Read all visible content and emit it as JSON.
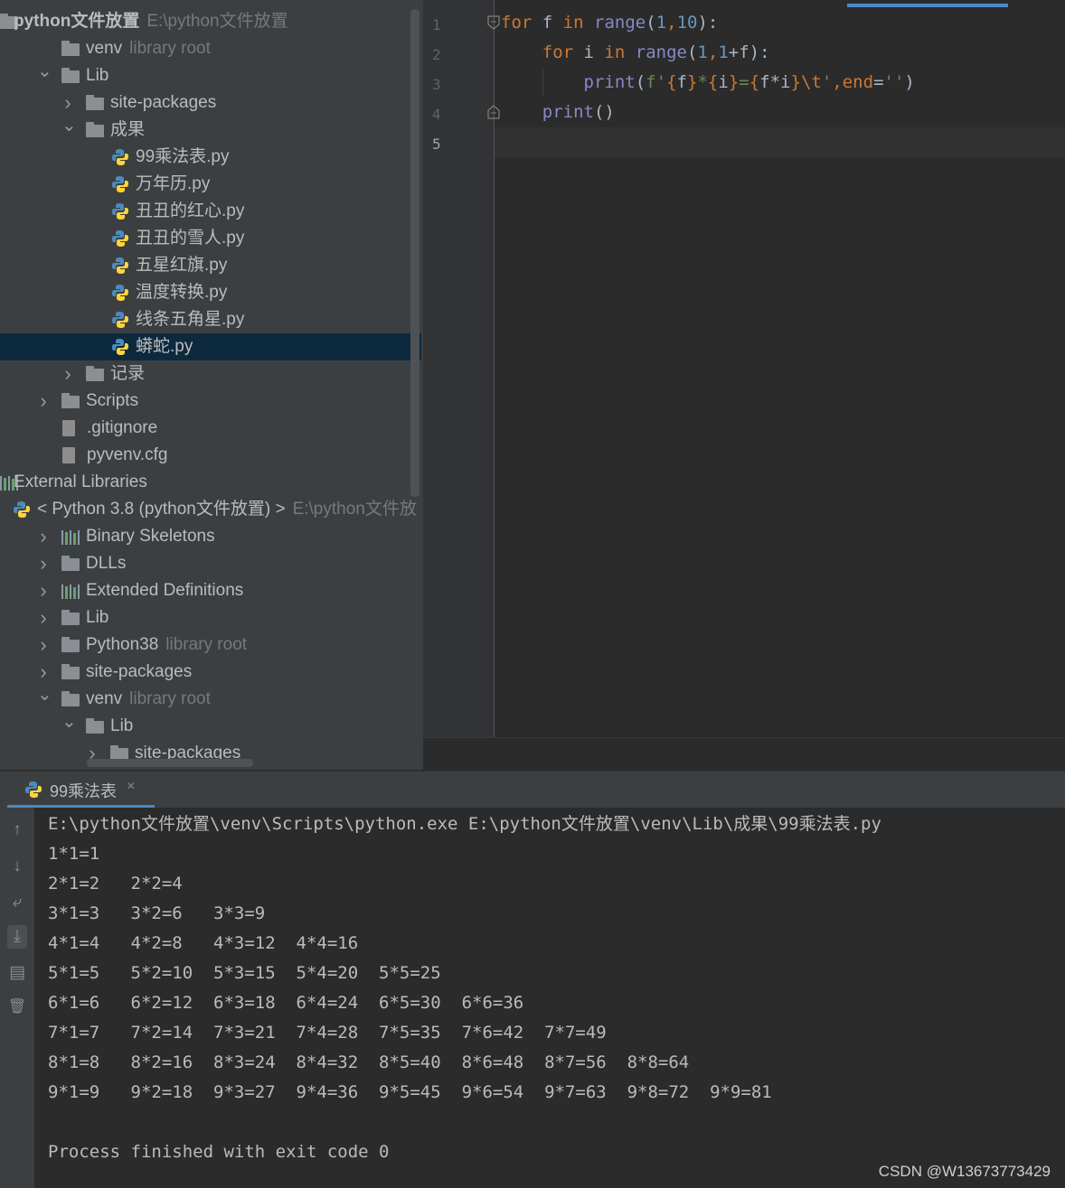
{
  "project_tree": {
    "rows": [
      {
        "label": "python文件放置",
        "hint": "E:\\python文件放置",
        "icon": "folder-icon",
        "indent": 0,
        "chev": ""
      },
      {
        "label": "venv",
        "hint": "library root",
        "icon": "folder-icon",
        "indent": 1,
        "chev": ""
      },
      {
        "label": "Lib",
        "hint": "",
        "icon": "folder-icon",
        "indent": 1,
        "chev": "down"
      },
      {
        "label": "site-packages",
        "hint": "",
        "icon": "folder-icon",
        "indent": 2,
        "chev": "right"
      },
      {
        "label": "成果",
        "hint": "",
        "icon": "folder-icon",
        "indent": 2,
        "chev": "down"
      },
      {
        "label": "99乘法表.py",
        "hint": "",
        "icon": "python-file-icon",
        "indent": 3,
        "chev": ""
      },
      {
        "label": "万年历.py",
        "hint": "",
        "icon": "python-file-icon",
        "indent": 3,
        "chev": ""
      },
      {
        "label": "丑丑的红心.py",
        "hint": "",
        "icon": "python-file-icon",
        "indent": 3,
        "chev": ""
      },
      {
        "label": "丑丑的雪人.py",
        "hint": "",
        "icon": "python-file-icon",
        "indent": 3,
        "chev": ""
      },
      {
        "label": "五星红旗.py",
        "hint": "",
        "icon": "python-file-icon",
        "indent": 3,
        "chev": ""
      },
      {
        "label": "温度转换.py",
        "hint": "",
        "icon": "python-file-icon",
        "indent": 3,
        "chev": ""
      },
      {
        "label": "线条五角星.py",
        "hint": "",
        "icon": "python-file-icon",
        "indent": 3,
        "chev": ""
      },
      {
        "label": "蟒蛇.py",
        "hint": "",
        "icon": "python-file-icon",
        "indent": 3,
        "chev": ""
      },
      {
        "label": "记录",
        "hint": "",
        "icon": "folder-icon",
        "indent": 2,
        "chev": "right"
      },
      {
        "label": "Scripts",
        "hint": "",
        "icon": "folder-icon",
        "indent": 1,
        "chev": "right"
      },
      {
        "label": ".gitignore",
        "hint": "",
        "icon": "ignore-file-icon",
        "indent": 1,
        "chev": ""
      },
      {
        "label": "pyvenv.cfg",
        "hint": "",
        "icon": "text-file-icon",
        "indent": 1,
        "chev": ""
      },
      {
        "label": "External Libraries",
        "hint": "",
        "icon": "library-icon",
        "indent": 0,
        "chev": ""
      },
      {
        "label": "< Python 3.8 (python文件放置) >",
        "hint": "E:\\python文件放",
        "icon": "python-icon",
        "indent": 0,
        "chev": ""
      },
      {
        "label": "Binary Skeletons",
        "hint": "",
        "icon": "library-icon",
        "indent": 1,
        "chev": "right"
      },
      {
        "label": "DLLs",
        "hint": "",
        "icon": "folder-icon",
        "indent": 1,
        "chev": "right"
      },
      {
        "label": "Extended Definitions",
        "hint": "",
        "icon": "library-icon",
        "indent": 1,
        "chev": "right"
      },
      {
        "label": "Lib",
        "hint": "",
        "icon": "folder-icon",
        "indent": 1,
        "chev": "right"
      },
      {
        "label": "Python38",
        "hint": "library root",
        "icon": "folder-icon",
        "indent": 1,
        "chev": "right"
      },
      {
        "label": "site-packages",
        "hint": "",
        "icon": "folder-icon",
        "indent": 1,
        "chev": "right"
      },
      {
        "label": "venv",
        "hint": "library root",
        "icon": "folder-icon",
        "indent": 1,
        "chev": "down"
      },
      {
        "label": "Lib",
        "hint": "",
        "icon": "folder-icon",
        "indent": 2,
        "chev": "down"
      },
      {
        "label": "site-packages",
        "hint": "",
        "icon": "folder-icon",
        "indent": 3,
        "chev": "right"
      }
    ],
    "selected_label": "蟒蛇.py"
  },
  "editor": {
    "line_numbers": [
      "1",
      "2",
      "3",
      "4",
      "5"
    ],
    "code": {
      "l1": {
        "kw_for": "for",
        "v_f": " f ",
        "kw_in": "in",
        "sp": " ",
        "fn_range": "range",
        "p1": "(",
        "n1": "1",
        ",": ",",
        "n10": "10",
        "p2": "):"
      },
      "l2": {
        "indent": "    ",
        "kw_for": "for",
        "v_i": " i ",
        "kw_in": "in",
        "sp": " ",
        "fn_range": "range",
        "p1": "(",
        "n1": "1",
        "c1": ",",
        "n1b": "1",
        "plus": "+f):"
      },
      "l3": {
        "indent": "        ",
        "fn_print": "print",
        "p1": "(",
        "pre": "f",
        "q1": "'",
        "b1": "{",
        "v1": "f",
        "b2": "}",
        "star": "*",
        "b3": "{",
        "v2": "i",
        "b4": "}",
        "eq": "=",
        "b5": "{",
        "v3": "f*i",
        "b6": "}",
        "esc": "\\t",
        "q2": "'",
        "comma": ",",
        "kw_end": "end",
        "eq2": "=",
        "s2": "''",
        "p2": ")"
      },
      "l4": {
        "indent": "    ",
        "fn_print": "print",
        "paren": "()"
      }
    }
  },
  "run_panel": {
    "tab_label": "99乘法表",
    "close_symbol": "×",
    "sidebar_glyphs": {
      "up": "↑",
      "down": "↓",
      "wrap": "⤶",
      "scroll_end": "⤓",
      "print": "▤",
      "trash": "🗑"
    },
    "output": [
      "E:\\python文件放置\\venv\\Scripts\\python.exe E:\\python文件放置\\venv\\Lib\\成果\\99乘法表.py",
      "1*1=1\t",
      "2*1=2\t2*2=4\t",
      "3*1=3\t3*2=6\t3*3=9\t",
      "4*1=4\t4*2=8\t4*3=12\t4*4=16\t",
      "5*1=5\t5*2=10\t5*3=15\t5*4=20\t5*5=25\t",
      "6*1=6\t6*2=12\t6*3=18\t6*4=24\t6*5=30\t6*6=36\t",
      "7*1=7\t7*2=14\t7*3=21\t7*4=28\t7*5=35\t7*6=42\t7*7=49\t",
      "8*1=8\t8*2=16\t8*3=24\t8*4=32\t8*5=40\t8*6=48\t8*7=56\t8*8=64\t",
      "9*1=9\t9*2=18\t9*3=27\t9*4=36\t9*5=45\t9*6=54\t9*7=63\t9*8=72\t9*9=81\t",
      "",
      "Process finished with exit code 0"
    ]
  },
  "watermark": "CSDN @W13673773429",
  "colors": {
    "keyword": "#cc7832",
    "builtin": "#8888c6",
    "number": "#6897bb",
    "string": "#6a8759",
    "selection": "#0d293e",
    "accent": "#4a88c7"
  }
}
